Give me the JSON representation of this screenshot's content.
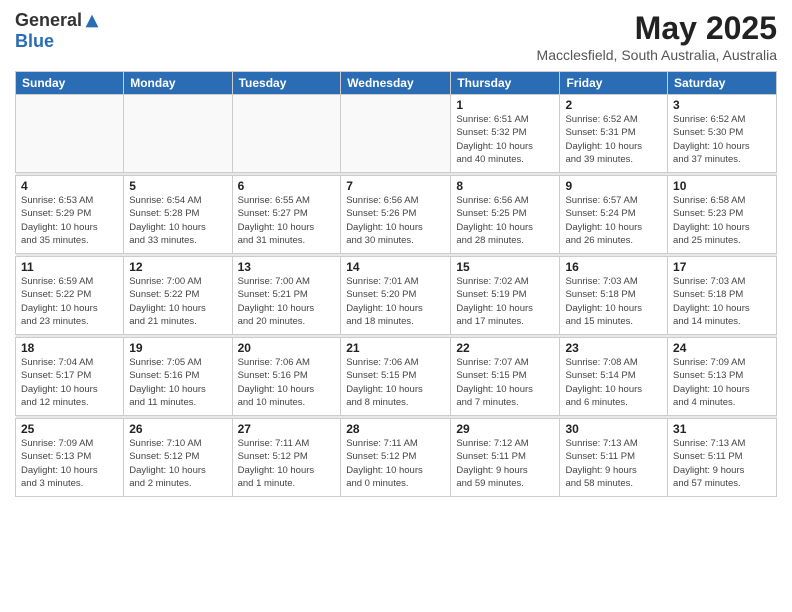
{
  "logo": {
    "general": "General",
    "blue": "Blue"
  },
  "title": "May 2025",
  "subtitle": "Macclesfield, South Australia, Australia",
  "headers": [
    "Sunday",
    "Monday",
    "Tuesday",
    "Wednesday",
    "Thursday",
    "Friday",
    "Saturday"
  ],
  "weeks": [
    [
      {
        "day": "",
        "info": ""
      },
      {
        "day": "",
        "info": ""
      },
      {
        "day": "",
        "info": ""
      },
      {
        "day": "",
        "info": ""
      },
      {
        "day": "1",
        "info": "Sunrise: 6:51 AM\nSunset: 5:32 PM\nDaylight: 10 hours\nand 40 minutes."
      },
      {
        "day": "2",
        "info": "Sunrise: 6:52 AM\nSunset: 5:31 PM\nDaylight: 10 hours\nand 39 minutes."
      },
      {
        "day": "3",
        "info": "Sunrise: 6:52 AM\nSunset: 5:30 PM\nDaylight: 10 hours\nand 37 minutes."
      }
    ],
    [
      {
        "day": "4",
        "info": "Sunrise: 6:53 AM\nSunset: 5:29 PM\nDaylight: 10 hours\nand 35 minutes."
      },
      {
        "day": "5",
        "info": "Sunrise: 6:54 AM\nSunset: 5:28 PM\nDaylight: 10 hours\nand 33 minutes."
      },
      {
        "day": "6",
        "info": "Sunrise: 6:55 AM\nSunset: 5:27 PM\nDaylight: 10 hours\nand 31 minutes."
      },
      {
        "day": "7",
        "info": "Sunrise: 6:56 AM\nSunset: 5:26 PM\nDaylight: 10 hours\nand 30 minutes."
      },
      {
        "day": "8",
        "info": "Sunrise: 6:56 AM\nSunset: 5:25 PM\nDaylight: 10 hours\nand 28 minutes."
      },
      {
        "day": "9",
        "info": "Sunrise: 6:57 AM\nSunset: 5:24 PM\nDaylight: 10 hours\nand 26 minutes."
      },
      {
        "day": "10",
        "info": "Sunrise: 6:58 AM\nSunset: 5:23 PM\nDaylight: 10 hours\nand 25 minutes."
      }
    ],
    [
      {
        "day": "11",
        "info": "Sunrise: 6:59 AM\nSunset: 5:22 PM\nDaylight: 10 hours\nand 23 minutes."
      },
      {
        "day": "12",
        "info": "Sunrise: 7:00 AM\nSunset: 5:22 PM\nDaylight: 10 hours\nand 21 minutes."
      },
      {
        "day": "13",
        "info": "Sunrise: 7:00 AM\nSunset: 5:21 PM\nDaylight: 10 hours\nand 20 minutes."
      },
      {
        "day": "14",
        "info": "Sunrise: 7:01 AM\nSunset: 5:20 PM\nDaylight: 10 hours\nand 18 minutes."
      },
      {
        "day": "15",
        "info": "Sunrise: 7:02 AM\nSunset: 5:19 PM\nDaylight: 10 hours\nand 17 minutes."
      },
      {
        "day": "16",
        "info": "Sunrise: 7:03 AM\nSunset: 5:18 PM\nDaylight: 10 hours\nand 15 minutes."
      },
      {
        "day": "17",
        "info": "Sunrise: 7:03 AM\nSunset: 5:18 PM\nDaylight: 10 hours\nand 14 minutes."
      }
    ],
    [
      {
        "day": "18",
        "info": "Sunrise: 7:04 AM\nSunset: 5:17 PM\nDaylight: 10 hours\nand 12 minutes."
      },
      {
        "day": "19",
        "info": "Sunrise: 7:05 AM\nSunset: 5:16 PM\nDaylight: 10 hours\nand 11 minutes."
      },
      {
        "day": "20",
        "info": "Sunrise: 7:06 AM\nSunset: 5:16 PM\nDaylight: 10 hours\nand 10 minutes."
      },
      {
        "day": "21",
        "info": "Sunrise: 7:06 AM\nSunset: 5:15 PM\nDaylight: 10 hours\nand 8 minutes."
      },
      {
        "day": "22",
        "info": "Sunrise: 7:07 AM\nSunset: 5:15 PM\nDaylight: 10 hours\nand 7 minutes."
      },
      {
        "day": "23",
        "info": "Sunrise: 7:08 AM\nSunset: 5:14 PM\nDaylight: 10 hours\nand 6 minutes."
      },
      {
        "day": "24",
        "info": "Sunrise: 7:09 AM\nSunset: 5:13 PM\nDaylight: 10 hours\nand 4 minutes."
      }
    ],
    [
      {
        "day": "25",
        "info": "Sunrise: 7:09 AM\nSunset: 5:13 PM\nDaylight: 10 hours\nand 3 minutes."
      },
      {
        "day": "26",
        "info": "Sunrise: 7:10 AM\nSunset: 5:12 PM\nDaylight: 10 hours\nand 2 minutes."
      },
      {
        "day": "27",
        "info": "Sunrise: 7:11 AM\nSunset: 5:12 PM\nDaylight: 10 hours\nand 1 minute."
      },
      {
        "day": "28",
        "info": "Sunrise: 7:11 AM\nSunset: 5:12 PM\nDaylight: 10 hours\nand 0 minutes."
      },
      {
        "day": "29",
        "info": "Sunrise: 7:12 AM\nSunset: 5:11 PM\nDaylight: 9 hours\nand 59 minutes."
      },
      {
        "day": "30",
        "info": "Sunrise: 7:13 AM\nSunset: 5:11 PM\nDaylight: 9 hours\nand 58 minutes."
      },
      {
        "day": "31",
        "info": "Sunrise: 7:13 AM\nSunset: 5:11 PM\nDaylight: 9 hours\nand 57 minutes."
      }
    ]
  ]
}
